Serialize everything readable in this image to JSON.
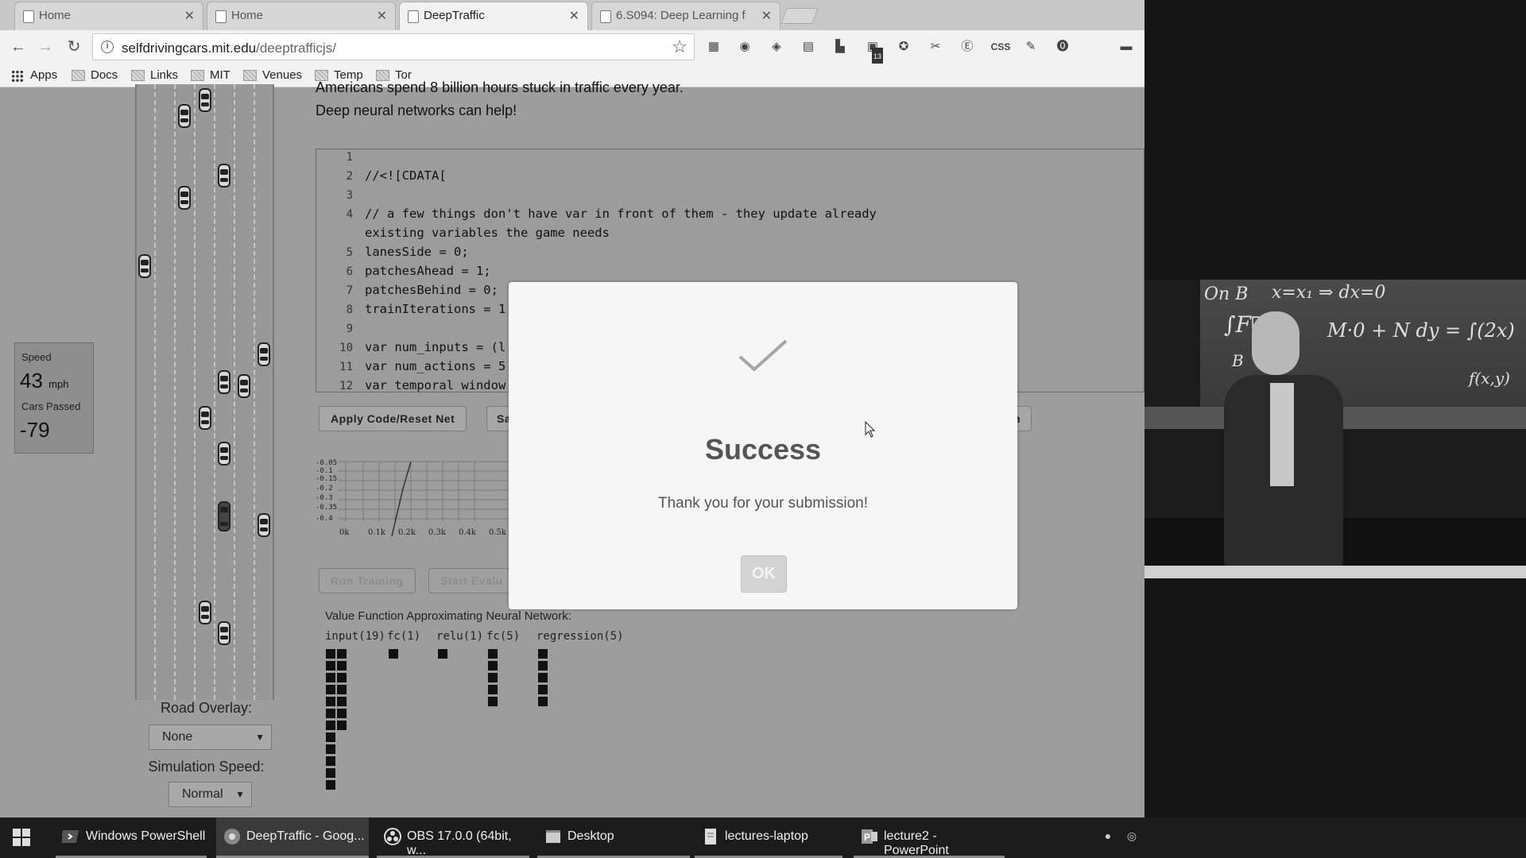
{
  "browser": {
    "tabs": [
      {
        "title": "Home"
      },
      {
        "title": "Home"
      },
      {
        "title": "DeepTraffic"
      },
      {
        "title": "6.S094: Deep Learning f"
      }
    ],
    "url_host": "selfdrivingcars.mit.edu",
    "url_path": "/deeptrafficjs/",
    "bookmarks": [
      "Apps",
      "Docs",
      "Links",
      "MIT",
      "Venues",
      "Temp",
      "Tor"
    ],
    "extension_badge": "13",
    "extension_css_label": "CSS"
  },
  "page": {
    "intro_line1": "Americans spend 8 billion hours stuck in traffic every year.",
    "intro_line2": "Deep neural networks can help!",
    "stats": {
      "speed_label": "Speed",
      "speed_value": "43",
      "speed_unit": "mph",
      "cars_passed_label": "Cars Passed",
      "cars_passed_value": "-79"
    },
    "road_overlay_label": "Road Overlay:",
    "road_overlay_value": "None",
    "sim_speed_label": "Simulation Speed:",
    "sim_speed_value": "Normal",
    "code_lines": [
      {
        "n": "1",
        "text": ""
      },
      {
        "n": "2",
        "text": "//<![CDATA["
      },
      {
        "n": "3",
        "text": ""
      },
      {
        "n": "4",
        "text": "// a few things don't have var in front of them - they update already"
      },
      {
        "n": "",
        "text": "existing variables the game needs"
      },
      {
        "n": "5",
        "text": "lanesSide = 0;"
      },
      {
        "n": "6",
        "text": "patchesAhead = 1;"
      },
      {
        "n": "7",
        "text": "patchesBehind = 0;"
      },
      {
        "n": "8",
        "text": "trainIterations = 1"
      },
      {
        "n": "9",
        "text": ""
      },
      {
        "n": "10",
        "text": "var num_inputs = (l"
      },
      {
        "n": "11",
        "text": "var num_actions = 5"
      },
      {
        "n": "12",
        "text": "var temporal_window"
      }
    ],
    "apply_button": "Apply Code/Reset Net",
    "save_button_partial": "Sa",
    "right_button_partial": "n",
    "run_training_button": "Run Training",
    "start_eval_button": "Start Evalu",
    "graph_xticks": [
      "0k",
      "0.1k",
      "0.2k",
      "0.3k",
      "0.4k",
      "0.5k"
    ],
    "nn_title": "Value Function Approximating Neural Network:",
    "nn_layers": [
      "input(19)",
      "fc(1)",
      "relu(1)",
      "fc(5)",
      "regression(5)"
    ]
  },
  "modal": {
    "title": "Success",
    "message": "Thank you for your submission!",
    "ok_label": "OK"
  },
  "taskbar": {
    "items": [
      "Windows PowerShell",
      "DeepTraffic - Goog...",
      "OBS 17.0.0 (64bit, w...",
      "Desktop",
      "lectures-laptop",
      "lecture2 - PowerPoint"
    ]
  },
  "camera": {
    "board_text_1": "On B",
    "board_text_2": "x=x₁  ⇒ dx=0",
    "board_text_3": "∫F⃗ d",
    "board_text_4": "M·0 + N dy = ∫(2x)",
    "board_text_5": "B",
    "board_text_6": "f(x,y)"
  }
}
